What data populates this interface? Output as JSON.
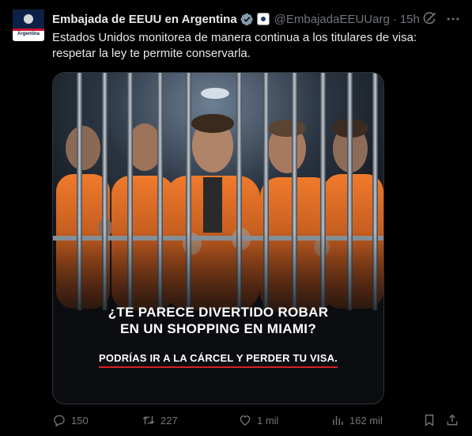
{
  "tweet": {
    "author_name": "Embajada de EEUU en Argentina",
    "handle": "@EmbajadaEEUUarg",
    "separator": "·",
    "time": "15h",
    "avatar_label": "Argentina",
    "text": "Estados Unidos monitorea de manera continua a los titulares de visa: respetar la ley te permite conservarla."
  },
  "media": {
    "headline_line1": "¿TE PARECE DIVERTIDO ROBAR",
    "headline_line2": "EN UN SHOPPING EN MIAMI?",
    "subline": "PODRÍAS IR A LA CÁRCEL Y PERDER TU VISA.",
    "accent_color": "#d81f26",
    "jumpsuit_color": "#e2661f"
  },
  "actions": {
    "replies": "150",
    "retweets": "227",
    "likes": "1 mil",
    "views": "162 mil"
  },
  "colors": {
    "background": "#000000",
    "text_primary": "#e7e9ea",
    "text_secondary": "#71767b",
    "verified": "#829aab"
  }
}
